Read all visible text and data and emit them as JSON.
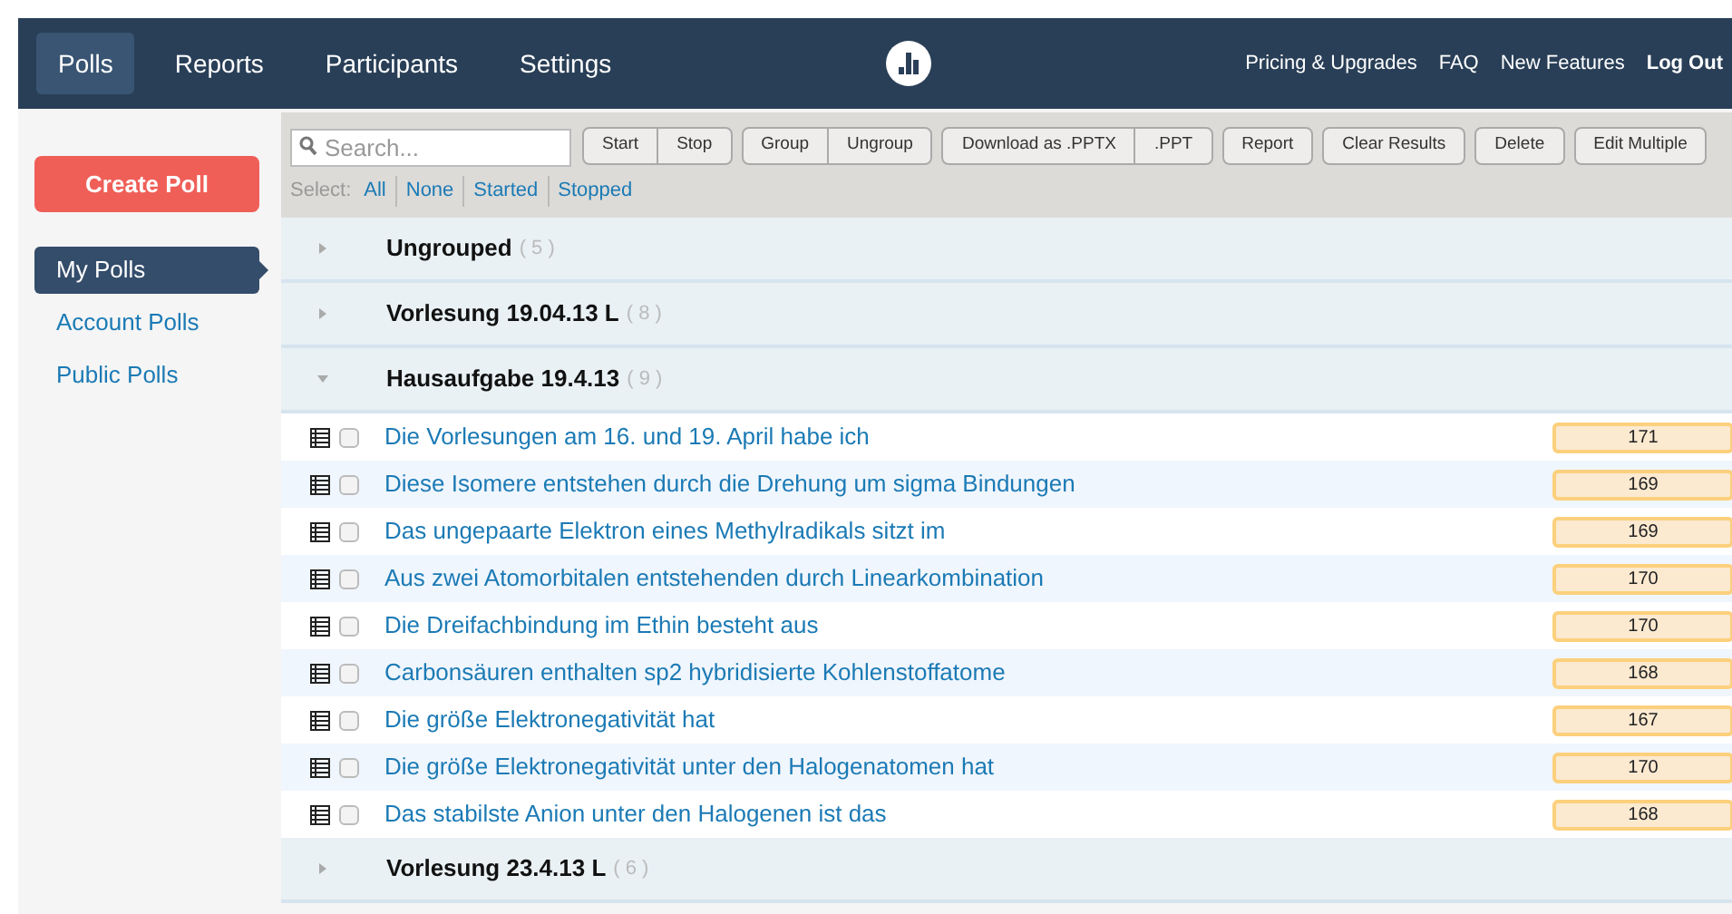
{
  "nav": {
    "tabs": [
      {
        "label": "Polls",
        "selected": true
      },
      {
        "label": "Reports",
        "selected": false
      },
      {
        "label": "Participants",
        "selected": false
      },
      {
        "label": "Settings",
        "selected": false
      }
    ],
    "links": [
      {
        "label": "Pricing & Upgrades",
        "bold": false
      },
      {
        "label": "FAQ",
        "bold": false
      },
      {
        "label": "New Features",
        "bold": false
      },
      {
        "label": "Log Out",
        "bold": true
      }
    ]
  },
  "sidebar": {
    "create_button": "Create Poll",
    "items": [
      {
        "label": "My Polls",
        "selected": true
      },
      {
        "label": "Account Polls",
        "selected": false
      },
      {
        "label": "Public Polls",
        "selected": false
      }
    ]
  },
  "toolbar": {
    "search": {
      "placeholder": "Search..."
    },
    "button_groups": [
      [
        "Start",
        "Stop"
      ],
      [
        "Group",
        "Ungroup"
      ],
      [
        "Download as .PPTX",
        ".PPT"
      ],
      [
        "Report"
      ],
      [
        "Clear Results"
      ],
      [
        "Delete"
      ],
      [
        "Edit Multiple"
      ]
    ],
    "select_label": "Select:",
    "select_links": [
      "All",
      "None",
      "Started",
      "Stopped"
    ]
  },
  "groups": [
    {
      "name": "Ungrouped",
      "count": "( 5 )",
      "expanded": false
    },
    {
      "name": "Vorlesung 19.04.13 L",
      "count": "( 8 )",
      "expanded": false
    },
    {
      "name": "Hausaufgabe 19.4.13",
      "count": "( 9 )",
      "expanded": true,
      "polls": [
        {
          "title": "Die Vorlesungen am 16. und 19. April habe ich",
          "responses": "171",
          "checked": false
        },
        {
          "title": "Diese Isomere entstehen durch die Drehung um sigma Bindungen",
          "responses": "169",
          "checked": false
        },
        {
          "title": "Das ungepaarte Elektron eines Methylradikals sitzt im",
          "responses": "169",
          "checked": false
        },
        {
          "title": "Aus zwei Atomorbitalen entstehenden durch Linearkombination",
          "responses": "170",
          "checked": false
        },
        {
          "title": "Die Dreifachbindung im Ethin besteht aus",
          "responses": "170",
          "checked": false
        },
        {
          "title": "Carbonsäuren enthalten sp2 hybridisierte Kohlenstoffatome",
          "responses": "168",
          "checked": false
        },
        {
          "title": "Die größe Elektronegativität hat",
          "responses": "167",
          "checked": false
        },
        {
          "title": "Die größe Elektronegativität unter den Halogenatomen hat",
          "responses": "170",
          "checked": false
        },
        {
          "title": "Das stabilste Anion unter den Halogenen ist das",
          "responses": "168",
          "checked": false
        }
      ]
    },
    {
      "name": "Vorlesung 23.4.13 L",
      "count": "( 6 )",
      "expanded": false
    }
  ]
}
